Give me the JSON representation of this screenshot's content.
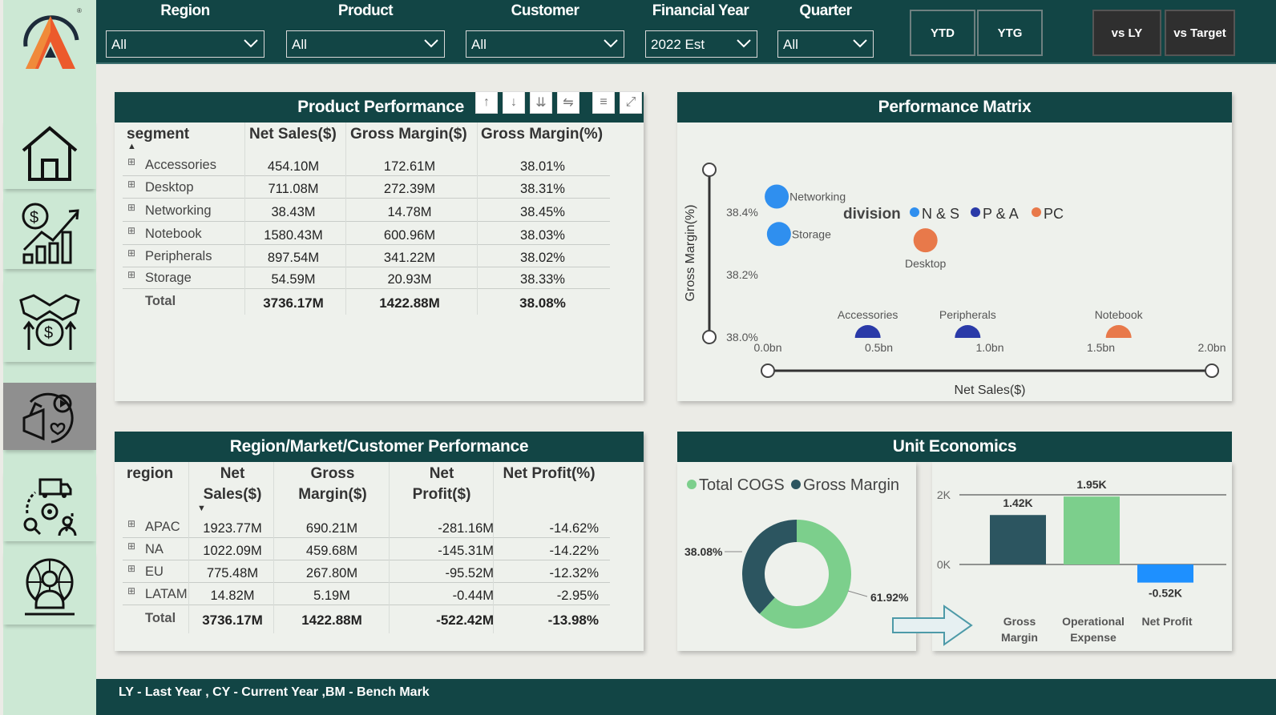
{
  "filters": [
    {
      "label": "Region",
      "value": "All"
    },
    {
      "label": "Product",
      "value": "All"
    },
    {
      "label": "Customer",
      "value": "All"
    },
    {
      "label": "Financial Year",
      "value": "2022 Est"
    },
    {
      "label": "Quarter",
      "value": "All"
    }
  ],
  "toggles": [
    "YTD",
    "YTG",
    "vs LY",
    "vs Target"
  ],
  "sidebar": {
    "items": [
      {
        "icon": "home-icon"
      },
      {
        "icon": "finance-chart-icon"
      },
      {
        "icon": "sales-handshake-icon"
      },
      {
        "icon": "marketing-megaphone-icon",
        "active": true
      },
      {
        "icon": "supply-chain-icon"
      },
      {
        "icon": "executive-globe-icon"
      }
    ]
  },
  "product_performance": {
    "title": "Product Performance",
    "headers": [
      "segment",
      "Net Sales($)",
      "Gross Margin($)",
      "Gross Margin(%)"
    ],
    "rows": [
      [
        "Accessories",
        "454.10M",
        "172.61M",
        "38.01%"
      ],
      [
        "Desktop",
        "711.08M",
        "272.39M",
        "38.31%"
      ],
      [
        "Networking",
        "38.43M",
        "14.78M",
        "38.45%"
      ],
      [
        "Notebook",
        "1580.43M",
        "600.96M",
        "38.03%"
      ],
      [
        "Peripherals",
        "897.54M",
        "341.22M",
        "38.02%"
      ],
      [
        "Storage",
        "54.59M",
        "20.93M",
        "38.33%"
      ]
    ],
    "total": [
      "Total",
      "3736.17M",
      "1422.88M",
      "38.08%"
    ]
  },
  "performance_matrix": {
    "title": "Performance Matrix",
    "legend_title": "division",
    "legend": [
      {
        "name": "N & S",
        "color": "#2f8fef"
      },
      {
        "name": "P & A",
        "color": "#2a3aa8"
      },
      {
        "name": "PC",
        "color": "#e8794a"
      }
    ]
  },
  "region_performance": {
    "title": "Region/Market/Customer Performance",
    "headers": [
      [
        "region"
      ],
      [
        "Net",
        "Sales($)"
      ],
      [
        "Gross",
        "Margin($)"
      ],
      [
        "Net",
        "Profit($)"
      ],
      [
        "Net Profit(%)"
      ]
    ],
    "rows": [
      [
        "APAC",
        "1923.77M",
        "690.21M",
        "-281.16M",
        "-14.62%"
      ],
      [
        "NA",
        "1022.09M",
        "459.68M",
        "-145.31M",
        "-14.22%"
      ],
      [
        "EU",
        "775.48M",
        "267.80M",
        "-95.52M",
        "-12.32%"
      ],
      [
        "LATAM",
        "14.82M",
        "5.19M",
        "-0.44M",
        "-2.95%"
      ]
    ],
    "total": [
      "Total",
      "3736.17M",
      "1422.88M",
      "-522.42M",
      "-13.98%"
    ]
  },
  "unit_economics": {
    "title": "Unit Economics",
    "legend": [
      {
        "name": "Total COGS",
        "color": "#7ccf8c"
      },
      {
        "name": "Gross Margin",
        "color": "#2c5560"
      }
    ]
  },
  "footer": "LY - Last Year , CY - Current Year ,BM - Bench Mark",
  "chart_data": [
    {
      "type": "scatter",
      "title": "Performance Matrix",
      "xlabel": "Net Sales($)",
      "ylabel": "Gross Margin(%)",
      "xlim": [
        0,
        2.0
      ],
      "ylim": [
        38.0,
        38.5
      ],
      "x_ticks": [
        "0.0bn",
        "0.5bn",
        "1.0bn",
        "1.5bn",
        "2.0bn"
      ],
      "y_ticks": [
        "38.0%",
        "38.2%",
        "38.4%"
      ],
      "points": [
        {
          "label": "Networking",
          "x": 0.04,
          "y": 38.45,
          "division": "N & S"
        },
        {
          "label": "Storage",
          "x": 0.05,
          "y": 38.33,
          "division": "N & S"
        },
        {
          "label": "Desktop",
          "x": 0.71,
          "y": 38.31,
          "division": "PC"
        },
        {
          "label": "Accessories",
          "x": 0.45,
          "y": 38.01,
          "division": "P & A"
        },
        {
          "label": "Peripherals",
          "x": 0.9,
          "y": 38.02,
          "division": "P & A"
        },
        {
          "label": "Notebook",
          "x": 1.58,
          "y": 38.03,
          "division": "PC"
        }
      ]
    },
    {
      "type": "pie",
      "title": "",
      "slices": [
        {
          "name": "Gross Margin",
          "value": 38.08,
          "label": "38.08%"
        },
        {
          "name": "Total COGS",
          "value": 61.92,
          "label": "61.92%"
        }
      ]
    },
    {
      "type": "bar",
      "title": "",
      "categories": [
        "Gross Margin",
        "Operational Expense",
        "Net Profit"
      ],
      "category_lines": [
        [
          "Gross",
          "Margin"
        ],
        [
          "Operational",
          "Expense"
        ],
        [
          "Net Profit"
        ]
      ],
      "values": [
        1.42,
        1.95,
        -0.52
      ],
      "value_labels": [
        "1.42K",
        "1.95K",
        "-0.52K"
      ],
      "y_ticks": [
        "0K",
        "2K"
      ],
      "colors": [
        "#2c5560",
        "#7ccf8c",
        "#1e90ff"
      ]
    }
  ]
}
